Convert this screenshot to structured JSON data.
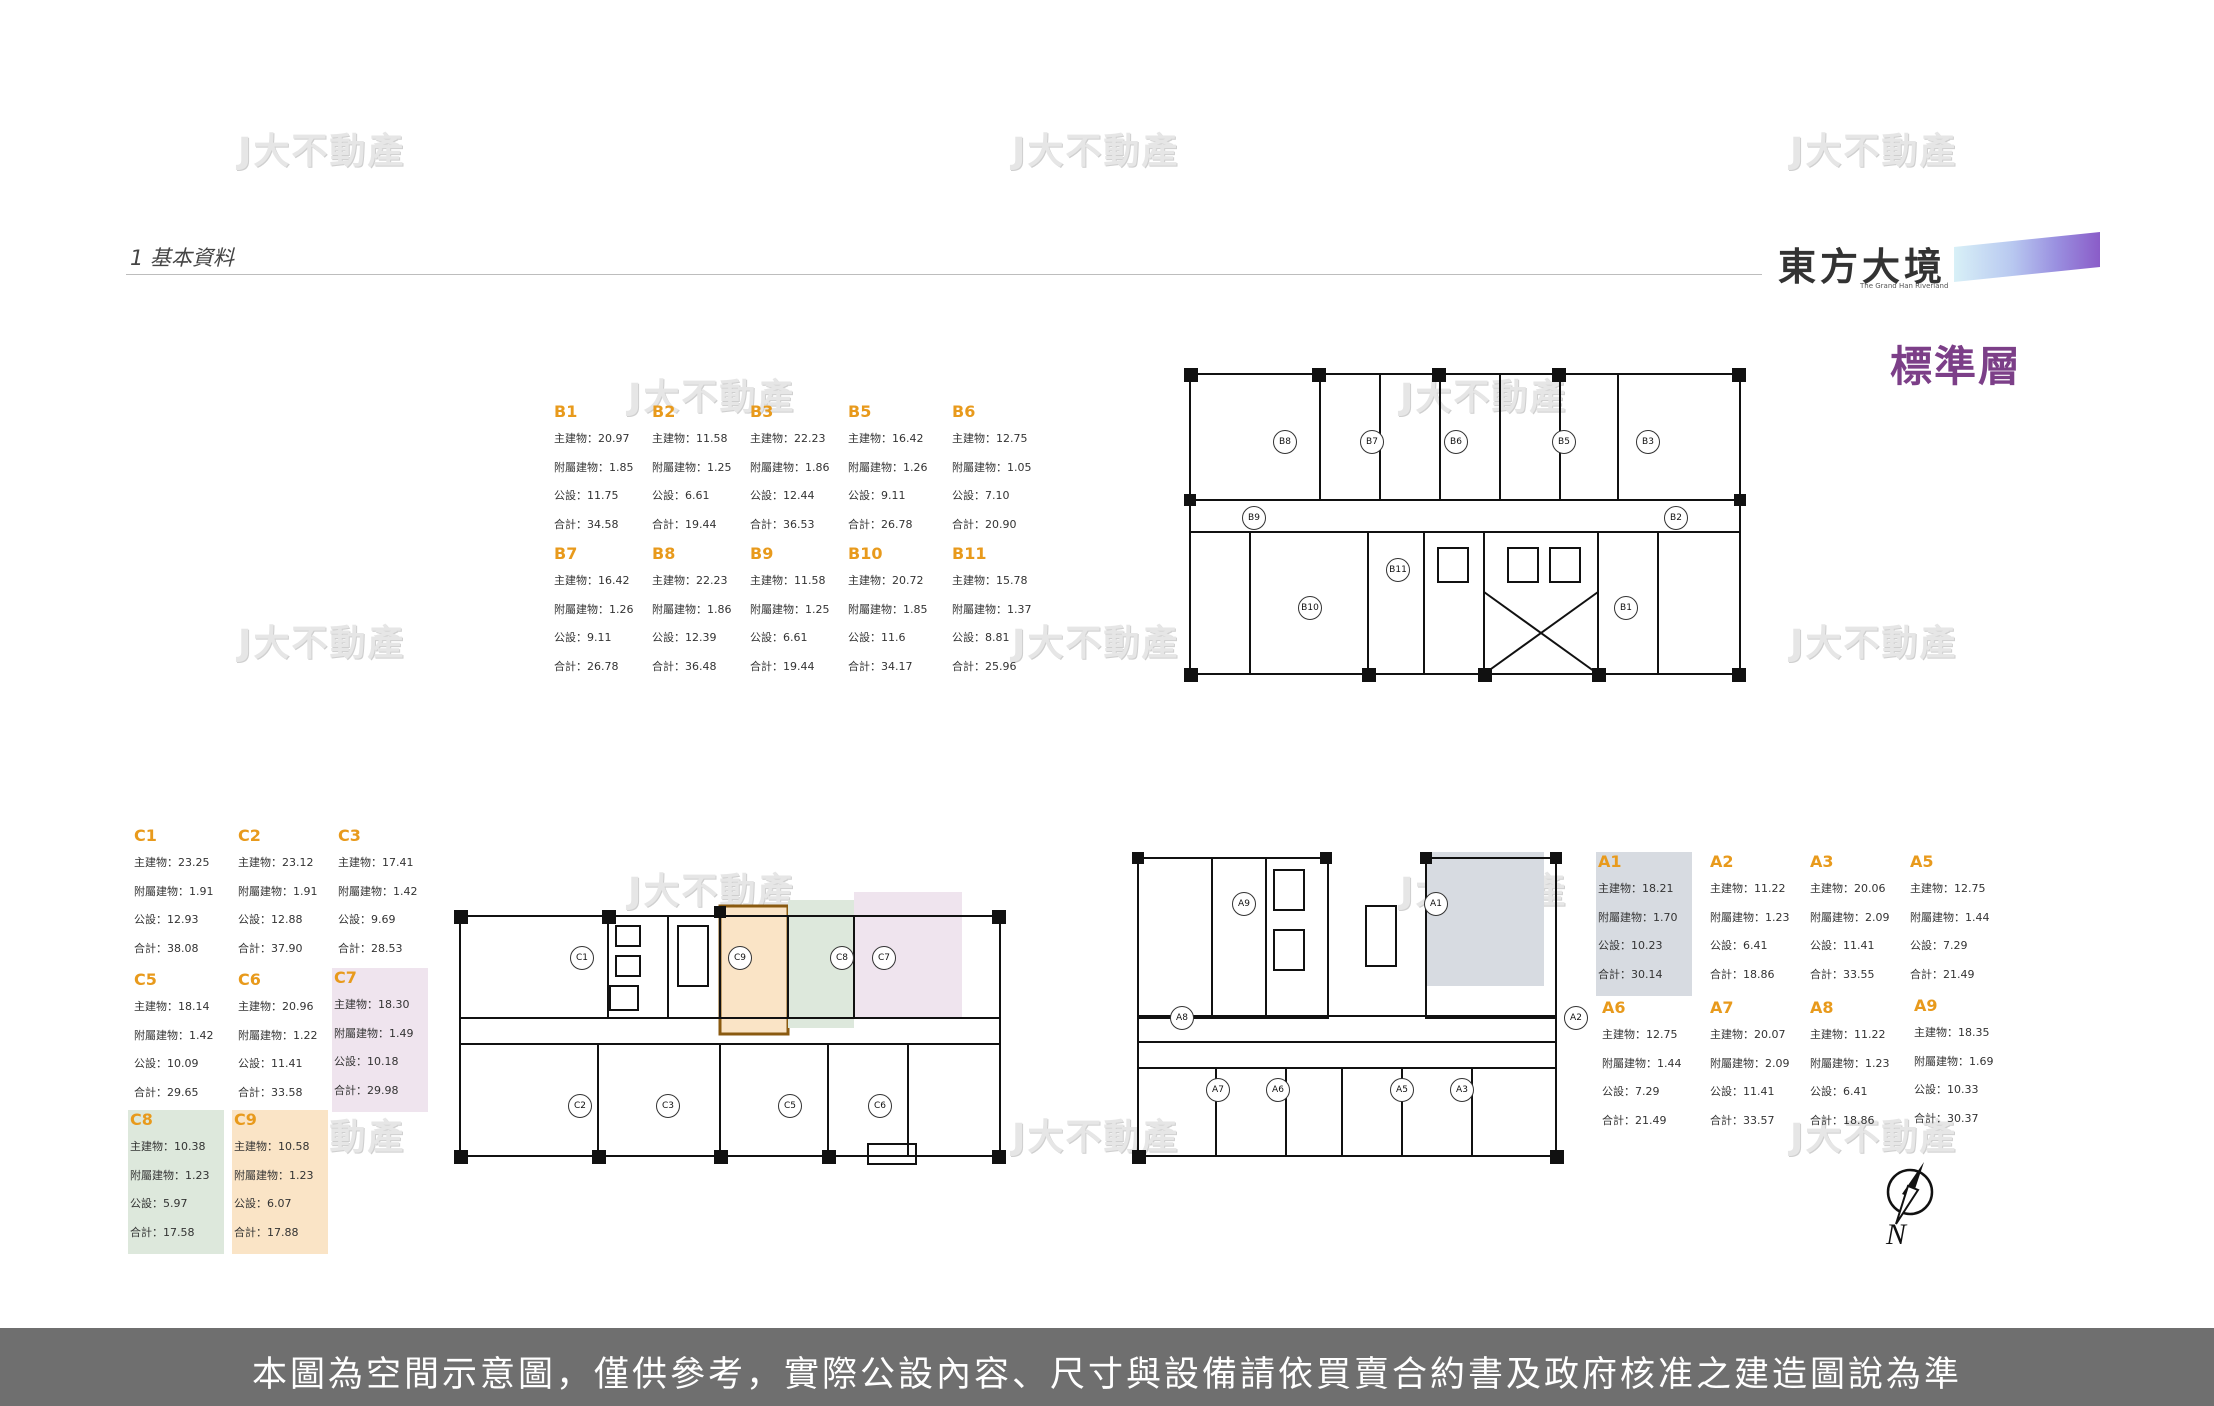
{
  "watermarks": [
    "J大不動產",
    "J大不動產",
    "J大不動產",
    "J大不動產",
    "J大不動產",
    "J大不動產",
    "J大不動產",
    "J大不動產",
    "J大不動產",
    "J大不動產",
    "J大不動產",
    "J大不動產",
    "J大不動產",
    "J大不動產"
  ],
  "header": {
    "section_label": "1 基本資料",
    "logo": "東方大境",
    "logo_sub": "The Grand Han Riverland",
    "floor_title": "標準層"
  },
  "units": {
    "B1": {
      "name": "B1",
      "main": "主建物：20.97",
      "attached": "附屬建物：1.85",
      "public": "公設：11.75",
      "total": "合計：34.58"
    },
    "B2": {
      "name": "B2",
      "main": "主建物：11.58",
      "attached": "附屬建物：1.25",
      "public": "公設：6.61",
      "total": "合計：19.44"
    },
    "B3": {
      "name": "B3",
      "main": "主建物：22.23",
      "attached": "附屬建物：1.86",
      "public": "公設：12.44",
      "total": "合計：36.53"
    },
    "B5": {
      "name": "B5",
      "main": "主建物：16.42",
      "attached": "附屬建物：1.26",
      "public": "公設：9.11",
      "total": "合計：26.78"
    },
    "B6": {
      "name": "B6",
      "main": "主建物：12.75",
      "attached": "附屬建物：1.05",
      "public": "公設：7.10",
      "total": "合計：20.90"
    },
    "B7": {
      "name": "B7",
      "main": "主建物：16.42",
      "attached": "附屬建物：1.26",
      "public": "公設：9.11",
      "total": "合計：26.78"
    },
    "B8": {
      "name": "B8",
      "main": "主建物：22.23",
      "attached": "附屬建物：1.86",
      "public": "公設：12.39",
      "total": "合計：36.48"
    },
    "B9": {
      "name": "B9",
      "main": "主建物：11.58",
      "attached": "附屬建物：1.25",
      "public": "公設：6.61",
      "total": "合計：19.44"
    },
    "B10": {
      "name": "B10",
      "main": "主建物：20.72",
      "attached": "附屬建物：1.85",
      "public": "公設：11.6",
      "total": "合計：34.17"
    },
    "B11": {
      "name": "B11",
      "main": "主建物：15.78",
      "attached": "附屬建物：1.37",
      "public": "公設：8.81",
      "total": "合計：25.96"
    },
    "C1": {
      "name": "C1",
      "main": "主建物：23.25",
      "attached": "附屬建物：1.91",
      "public": "公設：12.93",
      "total": "合計：38.08"
    },
    "C2": {
      "name": "C2",
      "main": "主建物：23.12",
      "attached": "附屬建物：1.91",
      "public": "公設：12.88",
      "total": "合計：37.90"
    },
    "C3": {
      "name": "C3",
      "main": "主建物：17.41",
      "attached": "附屬建物：1.42",
      "public": "公設：9.69",
      "total": "合計：28.53"
    },
    "C5": {
      "name": "C5",
      "main": "主建物：18.14",
      "attached": "附屬建物：1.42",
      "public": "公設：10.09",
      "total": "合計：29.65"
    },
    "C6": {
      "name": "C6",
      "main": "主建物：20.96",
      "attached": "附屬建物：1.22",
      "public": "公設：11.41",
      "total": "合計：33.58"
    },
    "C7": {
      "name": "C7",
      "main": "主建物：18.30",
      "attached": "附屬建物：1.49",
      "public": "公設：10.18",
      "total": "合計：29.98"
    },
    "C8": {
      "name": "C8",
      "main": "主建物：10.38",
      "attached": "附屬建物：1.23",
      "public": "公設：5.97",
      "total": "合計：17.58"
    },
    "C9": {
      "name": "C9",
      "main": "主建物：10.58",
      "attached": "附屬建物：1.23",
      "public": "公設：6.07",
      "total": "合計：17.88"
    },
    "A1": {
      "name": "A1",
      "main": "主建物：18.21",
      "attached": "附屬建物：1.70",
      "public": "公設：10.23",
      "total": "合計：30.14"
    },
    "A2": {
      "name": "A2",
      "main": "主建物：11.22",
      "attached": "附屬建物：1.23",
      "public": "公設：6.41",
      "total": "合計：18.86"
    },
    "A3": {
      "name": "A3",
      "main": "主建物：20.06",
      "attached": "附屬建物：2.09",
      "public": "公設：11.41",
      "total": "合計：33.55"
    },
    "A5": {
      "name": "A5",
      "main": "主建物：12.75",
      "attached": "附屬建物：1.44",
      "public": "公設：7.29",
      "total": "合計：21.49"
    },
    "A6": {
      "name": "A6",
      "main": "主建物：12.75",
      "attached": "附屬建物：1.44",
      "public": "公設：7.29",
      "total": "合計：21.49"
    },
    "A7": {
      "name": "A7",
      "main": "主建物：20.07",
      "attached": "附屬建物：2.09",
      "public": "公設：11.41",
      "total": "合計：33.57"
    },
    "A8": {
      "name": "A8",
      "main": "主建物：11.22",
      "attached": "附屬建物：1.23",
      "public": "公設：6.41",
      "total": "合計：18.86"
    },
    "A9": {
      "name": "A9",
      "main": "主建物：18.35",
      "attached": "附屬建物：1.69",
      "public": "公設：10.33",
      "total": "合計：30.37"
    }
  },
  "plan_labels": {
    "b": [
      "B8",
      "B7",
      "B6",
      "B5",
      "B3",
      "B9",
      "B2",
      "B11",
      "B10",
      "B1"
    ],
    "c": [
      "C1",
      "C9",
      "C8",
      "C7",
      "C2",
      "C3",
      "C5",
      "C6"
    ],
    "a": [
      "A9",
      "A1",
      "A8",
      "A2",
      "A7",
      "A6",
      "A5",
      "A3"
    ]
  },
  "compass": "N",
  "footer": "本圖為空間示意圖，僅供參考，實際公設內容、尺寸與設備請依買賣合約書及政府核准之建造圖說為準"
}
